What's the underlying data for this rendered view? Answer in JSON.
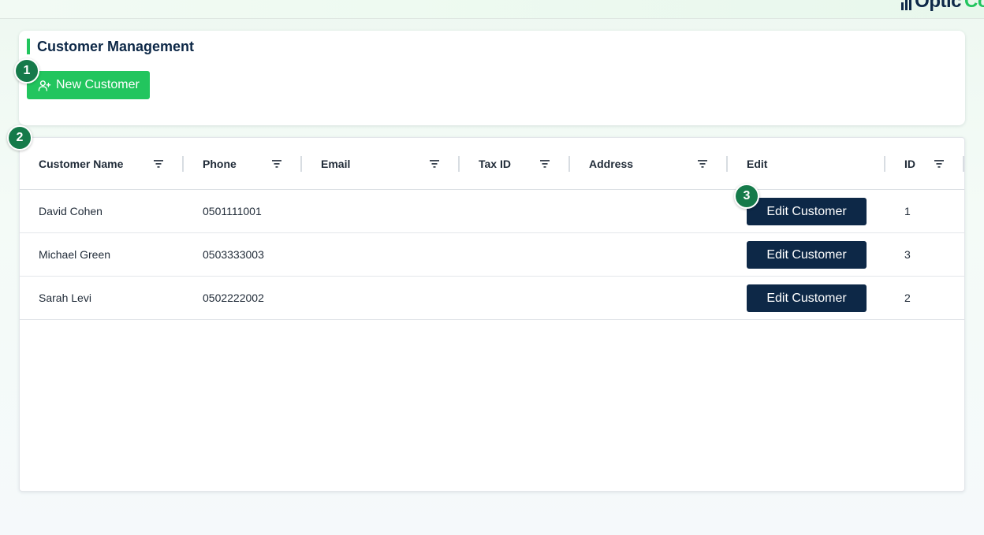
{
  "logo": {
    "text_a": "Optic",
    "text_b": "Co"
  },
  "panel": {
    "title": "Customer Management",
    "new_button_label": "New Customer"
  },
  "markers": [
    "1",
    "2",
    "3"
  ],
  "table": {
    "columns": [
      {
        "label": "Customer Name",
        "filter": true
      },
      {
        "label": "Phone",
        "filter": true
      },
      {
        "label": "Email",
        "filter": true
      },
      {
        "label": "Tax ID",
        "filter": true
      },
      {
        "label": "Address",
        "filter": true
      },
      {
        "label": "Edit",
        "filter": false
      },
      {
        "label": "ID",
        "filter": true
      }
    ],
    "rows": [
      {
        "name": "David Cohen",
        "phone": "0501111001",
        "email": "",
        "tax_id": "",
        "address": "",
        "edit_label": "Edit Customer",
        "id": "1"
      },
      {
        "name": "Michael Green",
        "phone": "0503333003",
        "email": "",
        "tax_id": "",
        "address": "",
        "edit_label": "Edit Customer",
        "id": "3"
      },
      {
        "name": "Sarah Levi",
        "phone": "0502222002",
        "email": "",
        "tax_id": "",
        "address": "",
        "edit_label": "Edit Customer",
        "id": "2"
      }
    ]
  },
  "colors": {
    "accent_green": "#22c55e",
    "navy": "#0d2847",
    "marker_green": "#157a4a"
  },
  "icons": {
    "new_button_icon": "add-user-icon",
    "column_filter_icon": "filter-icon"
  }
}
